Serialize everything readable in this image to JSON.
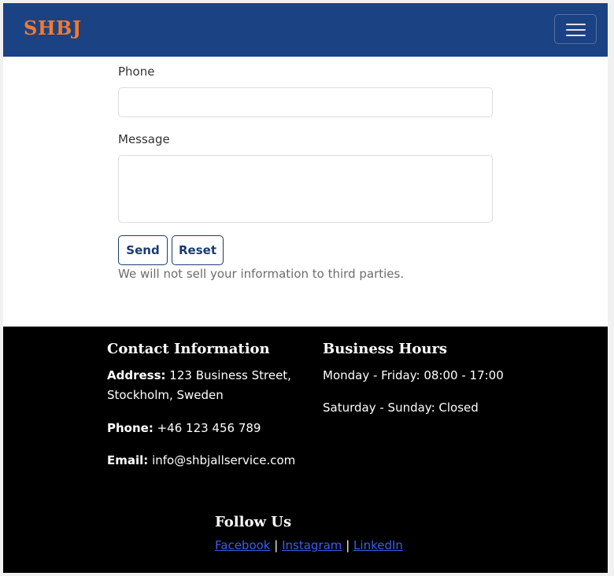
{
  "navbar": {
    "brand": "SHBJ",
    "menu_icon": "hamburger-menu-icon"
  },
  "form": {
    "phone_label": "Phone",
    "phone_value": "",
    "message_label": "Message",
    "message_value": "",
    "send_label": "Send",
    "reset_label": "Reset",
    "privacy_note": "We will not sell your information to third parties."
  },
  "footer": {
    "contact": {
      "heading": "Contact Information",
      "address_label": "Address:",
      "address_line1": "123 Business Street,",
      "address_line2": "Stockholm, Sweden",
      "phone_label": "Phone:",
      "phone_value": "+46 123 456 789",
      "email_label": "Email:",
      "email_value": "info@shbjallservice.com"
    },
    "hours": {
      "heading": "Business Hours",
      "weekdays": "Monday - Friday: 08:00 - 17:00",
      "weekend": "Saturday - Sunday: Closed"
    },
    "follow": {
      "heading": "Follow Us",
      "links": [
        "Facebook",
        "Instagram",
        "LinkedIn"
      ],
      "separator": "|"
    }
  },
  "colors": {
    "navbar_bg": "#1b4283",
    "brand": "#f47a2a",
    "button_border": "#1b3b6f",
    "footer_bg": "#000000",
    "link": "#3b5fe8"
  }
}
